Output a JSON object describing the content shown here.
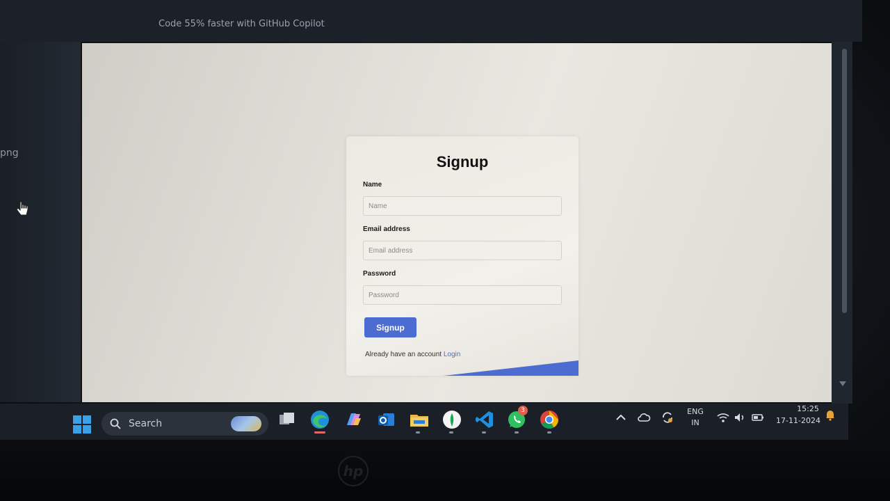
{
  "top_bar": {
    "text": "Code 55% faster with GitHub Copilot"
  },
  "left_panel": {
    "text": "png"
  },
  "form": {
    "title": "Signup",
    "name_label": "Name",
    "name_placeholder": "Name",
    "email_label": "Email address",
    "email_placeholder": "Email address",
    "password_label": "Password",
    "password_placeholder": "Password",
    "submit_label": "Signup",
    "footer_text": "Already have an account",
    "login_link": "Login",
    "accent_color": "#4d6cd1"
  },
  "taskbar": {
    "search_label": "Search",
    "apps": [
      {
        "icon": "task-view-icon"
      },
      {
        "icon": "edge-icon",
        "active": true
      },
      {
        "icon": "copilot-icon"
      },
      {
        "icon": "outlook-icon"
      },
      {
        "icon": "file-explorer-icon"
      },
      {
        "icon": "mongodb-compass-icon"
      },
      {
        "icon": "vscode-icon"
      },
      {
        "icon": "whatsapp-icon"
      },
      {
        "icon": "chrome-icon"
      }
    ],
    "whatsapp_badge": "3",
    "language": "ENG",
    "region": "IN",
    "time": "15:25",
    "date": "17-11-2024"
  }
}
